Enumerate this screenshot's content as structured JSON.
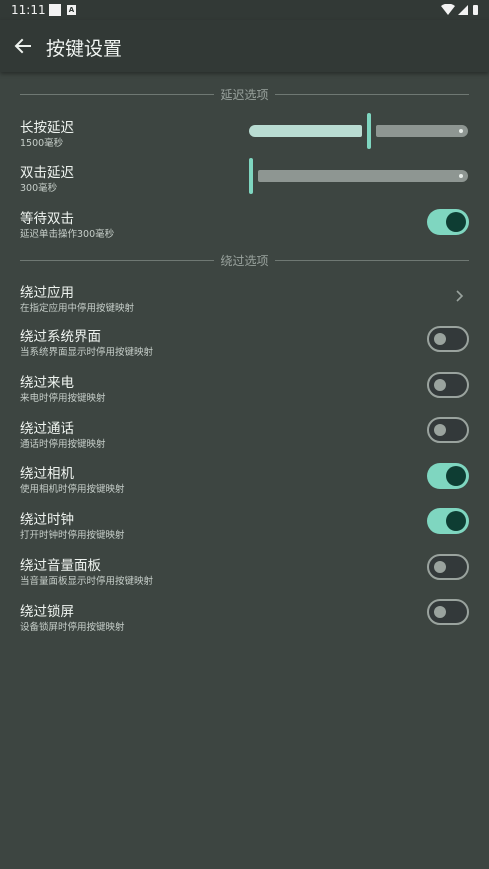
{
  "status_bar": {
    "time": "11:11"
  },
  "app_bar": {
    "title": "按键设置"
  },
  "sections": {
    "delay": {
      "label": "延迟选项"
    },
    "bypass": {
      "label": "绕过选项"
    }
  },
  "long_press": {
    "title": "长按延迟",
    "summary": "1500毫秒",
    "fraction": 0.55
  },
  "double_tap": {
    "title": "双击延迟",
    "summary": "300毫秒",
    "fraction": 0.0
  },
  "wait_double": {
    "title": "等待双击",
    "summary": "延迟单击操作300毫秒",
    "checked": true
  },
  "bypass_apps": {
    "title": "绕过应用",
    "summary": "在指定应用中停用按键映射"
  },
  "bypass_system_ui": {
    "title": "绕过系统界面",
    "summary": "当系统界面显示时停用按键映射",
    "checked": false
  },
  "bypass_incoming": {
    "title": "绕过来电",
    "summary": "来电时停用按键映射",
    "checked": false
  },
  "bypass_call": {
    "title": "绕过通话",
    "summary": "通话时停用按键映射",
    "checked": false
  },
  "bypass_camera": {
    "title": "绕过相机",
    "summary": "使用相机时停用按键映射",
    "checked": true
  },
  "bypass_clock": {
    "title": "绕过时钟",
    "summary": "打开时钟时停用按键映射",
    "checked": true
  },
  "bypass_volume": {
    "title": "绕过音量面板",
    "summary": "当音量面板显示时停用按键映射",
    "checked": false
  },
  "bypass_lock": {
    "title": "绕过锁屏",
    "summary": "设备锁屏时停用按键映射",
    "checked": false
  },
  "colors": {
    "accent": "#7fd6c0",
    "background": "#3d4541",
    "bar": "#323936"
  },
  "icons": {
    "back": "arrow-back-icon",
    "chevron": "chevron-right-icon"
  }
}
